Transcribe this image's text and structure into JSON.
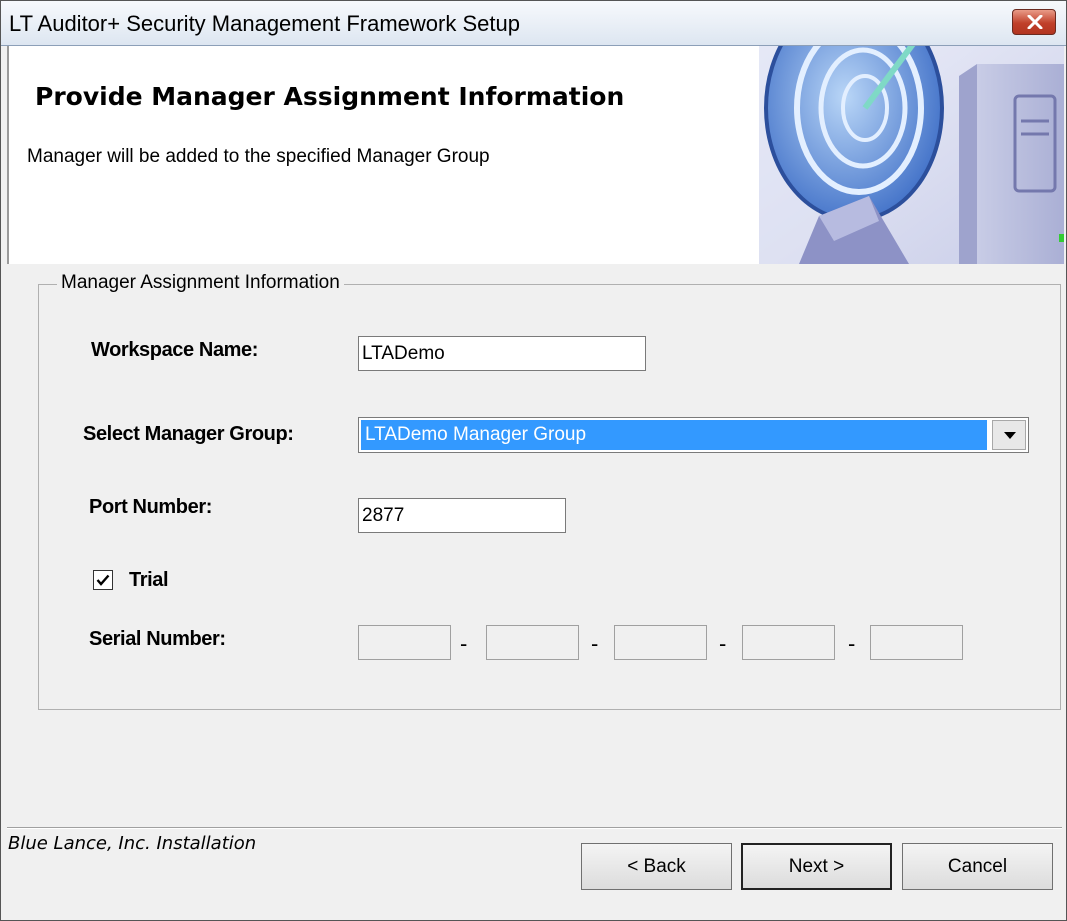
{
  "window": {
    "title": "LT Auditor+ Security Management Framework Setup",
    "close_icon": "close-icon"
  },
  "header": {
    "title": "Provide Manager Assignment Information",
    "subtitle": "Manager will be added to the specified Manager Group",
    "art_icon": "radar-dish-graphic"
  },
  "group": {
    "legend": "Manager Assignment Information"
  },
  "fields": {
    "workspace_label": "Workspace Name:",
    "workspace_value": "LTADemo",
    "manager_group_label": "Select Manager Group:",
    "manager_group_value": "LTADemo Manager Group",
    "port_label": "Port Number:",
    "port_value": "2877",
    "trial_label": "Trial",
    "trial_checked": true,
    "serial_label": "Serial Number:",
    "serial_segments": [
      "",
      "",
      "",
      "",
      ""
    ],
    "serial_separator": "-"
  },
  "footer": {
    "text": "Blue Lance, Inc. Installation",
    "back_label": "< Back",
    "next_label": "Next >",
    "cancel_label": "Cancel"
  },
  "colors": {
    "selection": "#3399ff",
    "close_button": "#c0402a",
    "dialog_background": "#f0f0f0"
  }
}
